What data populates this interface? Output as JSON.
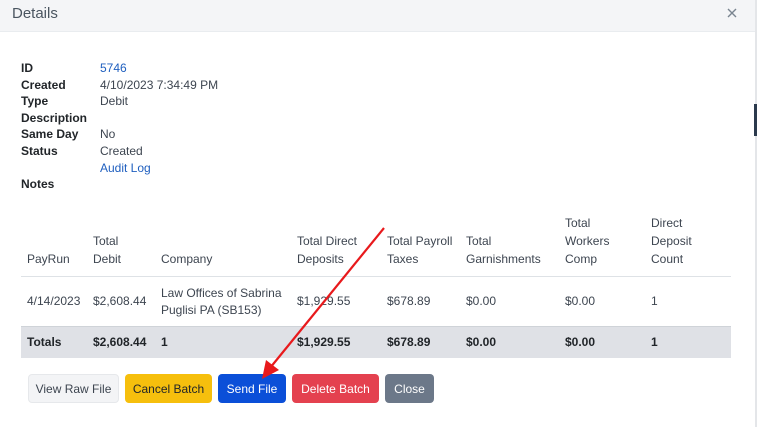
{
  "modal": {
    "title": "Details"
  },
  "details": {
    "id": {
      "label": "ID",
      "value": "5746"
    },
    "created": {
      "label": "Created",
      "value": "4/10/2023 7:34:49 PM"
    },
    "type": {
      "label": "Type",
      "value": "Debit"
    },
    "description": {
      "label": "Description",
      "value": ""
    },
    "same_day": {
      "label": "Same Day",
      "value": "No"
    },
    "status": {
      "label": "Status",
      "value": "Created",
      "link": "Audit Log"
    },
    "notes": {
      "label": "Notes",
      "value": ""
    }
  },
  "table": {
    "headers": {
      "payrun": "PayRun",
      "total_debit_1": "Total",
      "total_debit_2": "Debit",
      "company": "Company",
      "tdd_1": "Total Direct",
      "tdd_2": "Deposits",
      "tpt_1": "Total Payroll",
      "tpt_2": "Taxes",
      "tg_1": "Total",
      "tg_2": "Garnishments",
      "twc_1": "Total",
      "twc_2": "Workers",
      "twc_3": "Comp",
      "ddc_1": "Direct",
      "ddc_2": "Deposit",
      "ddc_3": "Count"
    },
    "row": {
      "payrun": "4/14/2023",
      "total_debit": "$2,608.44",
      "company_line1": "Law Offices of Sabrina",
      "company_line2": "Puglisi PA (SB153)",
      "total_direct_deposits": "$1,929.55",
      "total_payroll_taxes": "$678.89",
      "total_garnishments": "$0.00",
      "total_workers_comp": "$0.00",
      "direct_deposit_count": "1"
    },
    "totals": {
      "label": "Totals",
      "total_debit": "$2,608.44",
      "company": "1",
      "total_direct_deposits": "$1,929.55",
      "total_payroll_taxes": "$678.89",
      "total_garnishments": "$0.00",
      "total_workers_comp": "$0.00",
      "direct_deposit_count": "1"
    }
  },
  "buttons": {
    "view_raw_file": "View Raw File",
    "cancel_batch": "Cancel Batch",
    "send_file": "Send File",
    "delete_batch": "Delete Batch",
    "close": "Close"
  },
  "colors": {
    "link": "#1f5fbf",
    "send": "#0b4fd8",
    "cancel": "#f6bf0d",
    "delete": "#e4414f",
    "close": "#6c7889",
    "arrow": "#e8191c"
  },
  "icons": {
    "close": "close-x-icon",
    "annotation": "red-arrow-annotation"
  }
}
